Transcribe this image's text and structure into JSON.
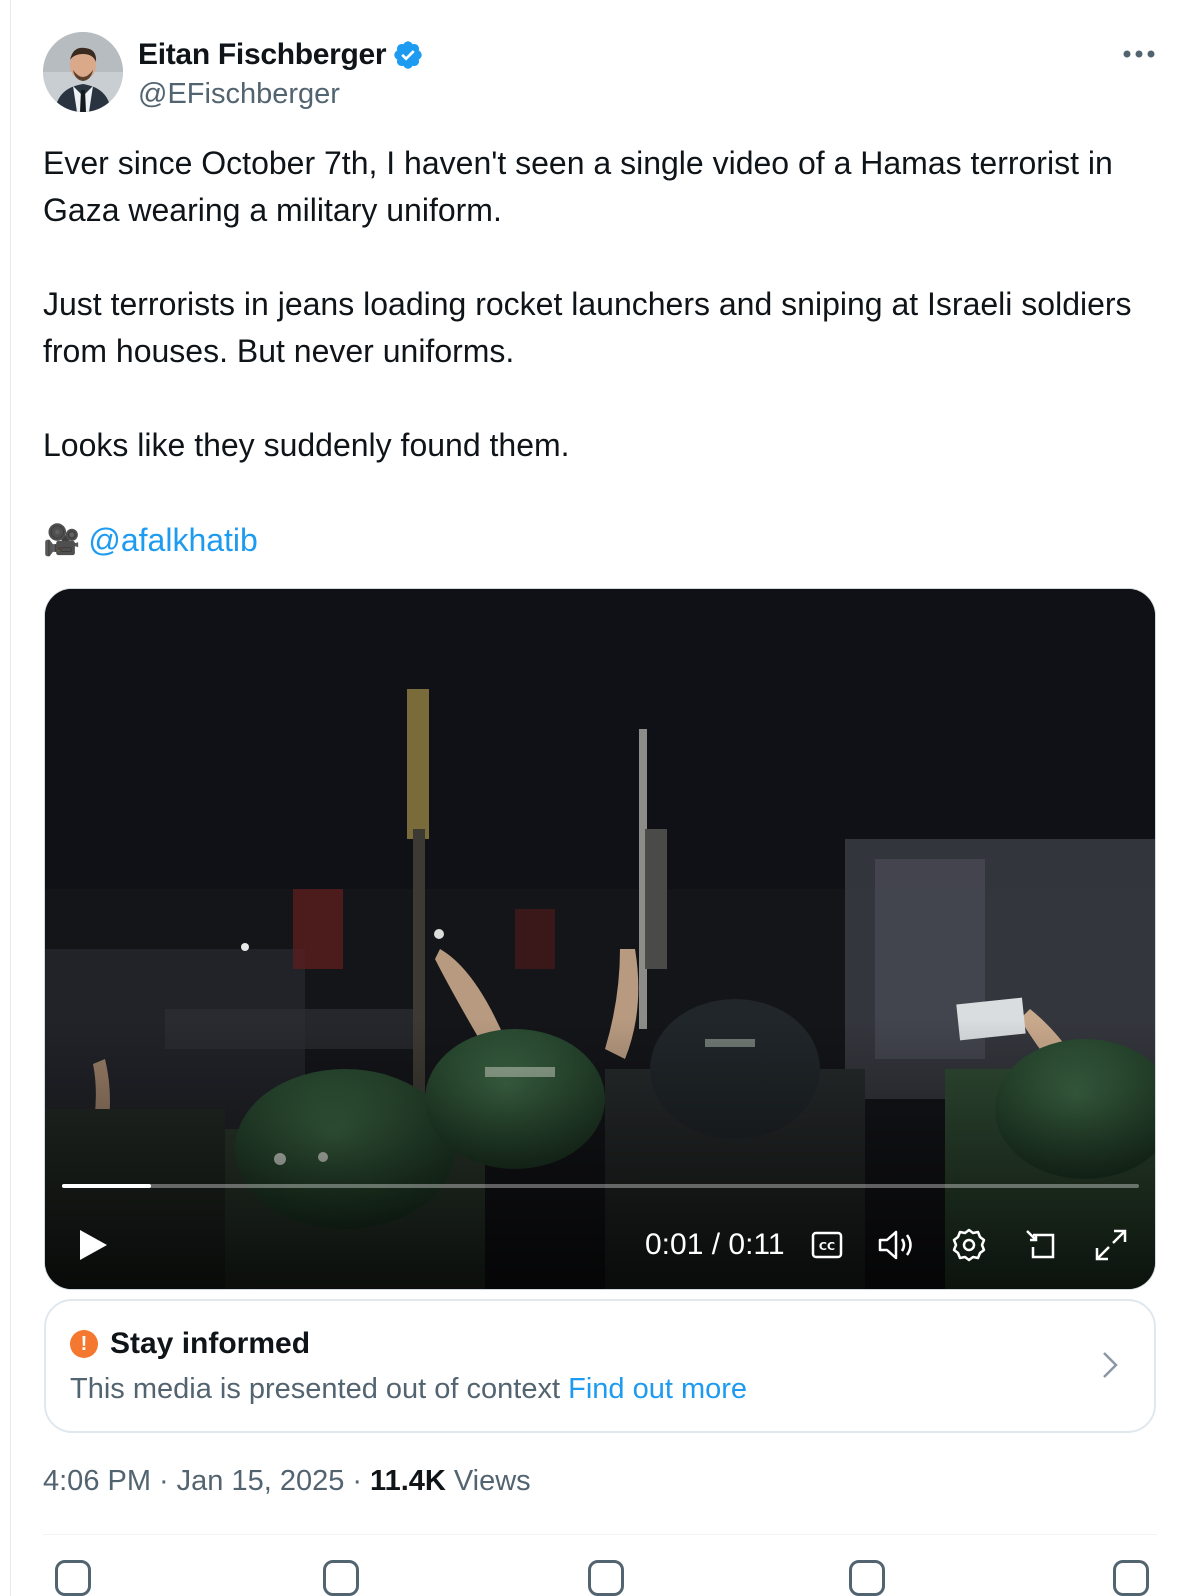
{
  "author": {
    "display_name": "Eitan Fischberger",
    "handle": "@EFischberger",
    "verified": true
  },
  "tweet": {
    "paragraphs": [
      "Ever since October 7th, I haven't seen a single video of a Hamas terrorist in Gaza wearing a military uniform.",
      "Just terrorists in jeans loading rocket launchers and sniping at Israeli soldiers from houses. But never uniforms.",
      "Looks like they suddenly found them."
    ],
    "credit_icon": "🎥",
    "credit_mention": "@afalkhatib"
  },
  "video": {
    "time_display": "0:01 / 0:11",
    "progress_fraction": 0.083,
    "controls": [
      "play-icon",
      "captions-icon",
      "volume-icon",
      "settings-icon",
      "pip-icon",
      "fullscreen-icon"
    ]
  },
  "notice": {
    "title": "Stay informed",
    "body": "This media is presented out of context",
    "link": "Find out more"
  },
  "meta": {
    "time": "4:06 PM",
    "date": "Jan 15, 2025",
    "views_count": "11.4K",
    "views_label": "Views",
    "separator": "·"
  },
  "colors": {
    "link": "#1d9bf0",
    "secondary_text": "#536471",
    "verified": "#1d9bf0",
    "alert": "#f4782f"
  }
}
